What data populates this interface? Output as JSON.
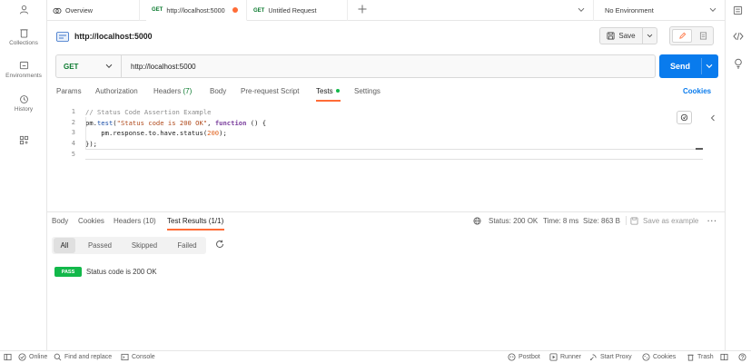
{
  "sidebar": {
    "items": [
      {
        "label": ""
      },
      {
        "label": "Collections"
      },
      {
        "label": "Environments"
      },
      {
        "label": "History"
      },
      {
        "label": ""
      }
    ]
  },
  "tabs": [
    {
      "label": "Overview"
    },
    {
      "method": "GET",
      "label": "http://localhost:5000",
      "unsaved": true
    },
    {
      "method": "GET",
      "label": "Untitled Request"
    }
  ],
  "environment": {
    "selected": "No Environment"
  },
  "request": {
    "title": "http://localhost:5000",
    "save_label": "Save",
    "method": "GET",
    "url": "http://localhost:5000",
    "send_label": "Send",
    "tabs": [
      {
        "label": "Params"
      },
      {
        "label": "Authorization"
      },
      {
        "label": "Headers",
        "count": "(7)"
      },
      {
        "label": "Body"
      },
      {
        "label": "Pre-request Script"
      },
      {
        "label": "Tests"
      },
      {
        "label": "Settings"
      }
    ],
    "cookies_label": "Cookies"
  },
  "editor": {
    "line_numbers": [
      "1",
      "2",
      "3",
      "4",
      "5"
    ],
    "line1": "// Status Code Assertion Example",
    "line2": {
      "obj": "pm",
      "dot": ".",
      "fn": "test",
      "paren": "(",
      "str": "\"Status code is 200 OK\"",
      "comma": ", ",
      "kw": "function",
      "rest": " () {"
    },
    "line3": {
      "prefix": "    pm.response.to.have.status(",
      "num": "200",
      "suffix": ");"
    },
    "line4": "});",
    "line5": ""
  },
  "response": {
    "tabs": [
      {
        "label": "Body"
      },
      {
        "label": "Cookies"
      },
      {
        "label": "Headers (10)"
      },
      {
        "label": "Test Results (1/1)"
      }
    ],
    "status": "Status: 200 OK",
    "time": "Time: 8 ms",
    "size": "Size: 863 B",
    "save_example": "Save as example",
    "filters": [
      "All",
      "Passed",
      "Skipped",
      "Failed"
    ],
    "results": [
      {
        "badge": "PASS",
        "text": "Status code is 200 OK"
      }
    ]
  },
  "statusbar": {
    "left": [
      "Online",
      "Find and replace",
      "Console"
    ],
    "right": [
      "Postbot",
      "Runner",
      "Start Proxy",
      "Cookies",
      "Trash"
    ]
  },
  "colors": {
    "accent": "#097bed",
    "orange": "#ff6c37",
    "pass": "#12b84a",
    "get": "#0a7a2e"
  }
}
